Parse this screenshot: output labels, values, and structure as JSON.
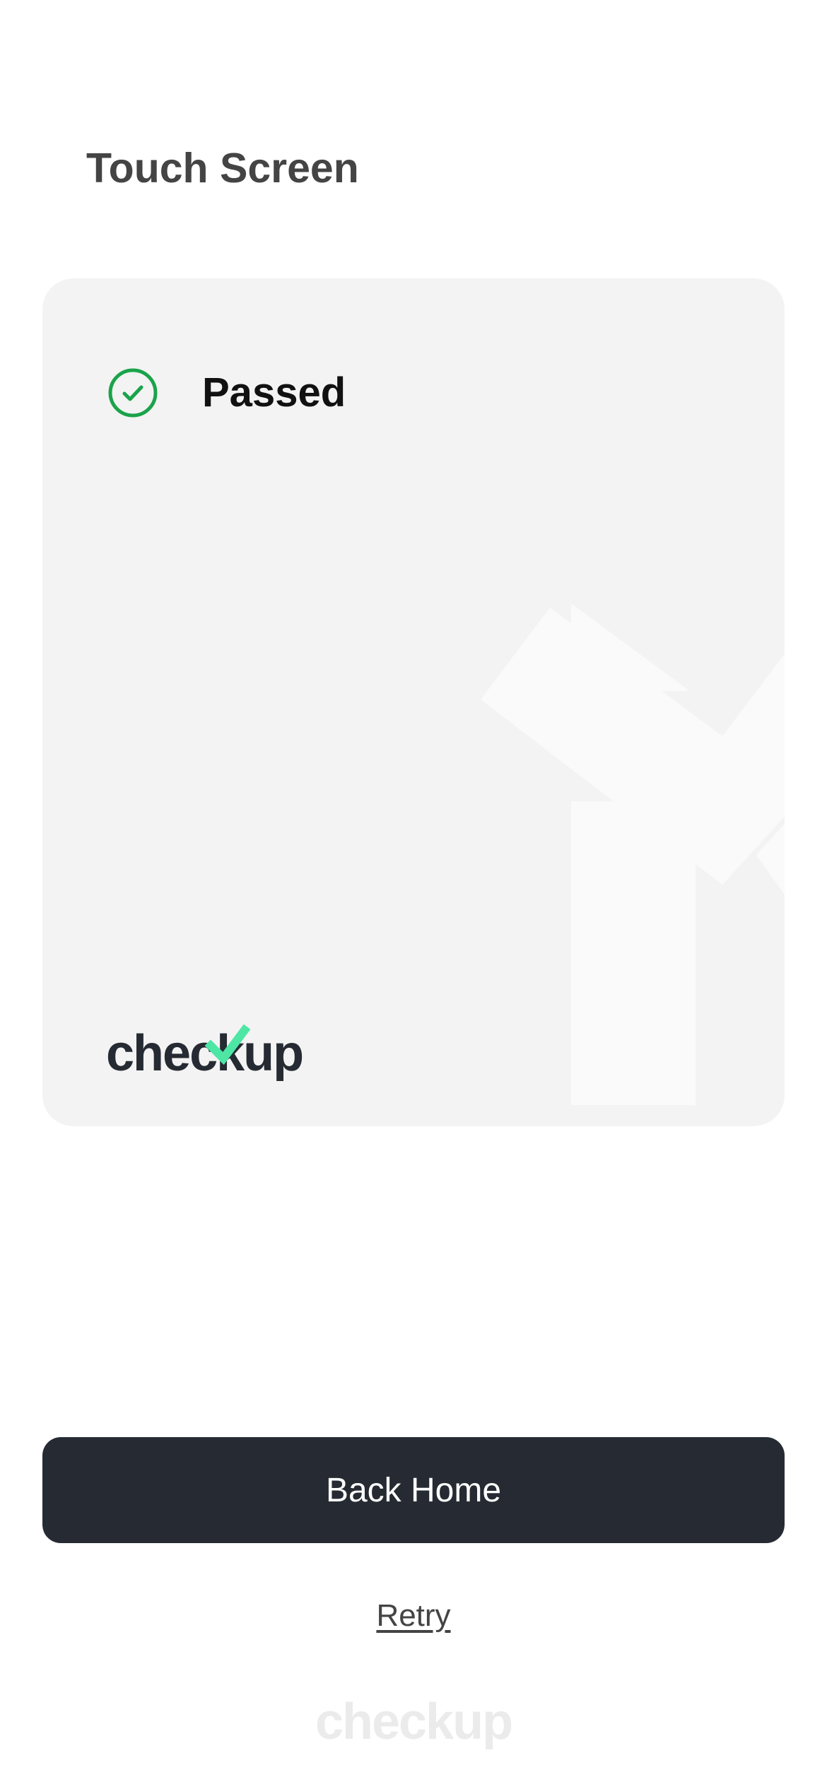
{
  "header": {
    "title": "Touch Screen"
  },
  "result_card": {
    "status_label": "Passed",
    "status_icon": "check-circle-icon",
    "brand_logo_text": "checkup"
  },
  "actions": {
    "primary_label": "Back Home",
    "secondary_label": "Retry"
  },
  "footer": {
    "brand_logo_text": "checkup"
  },
  "colors": {
    "primary": "#262b33",
    "success": "#1aa34a",
    "brand_accent": "#4ee6a5",
    "card_background": "#f3f3f3",
    "title_text": "#444444"
  }
}
